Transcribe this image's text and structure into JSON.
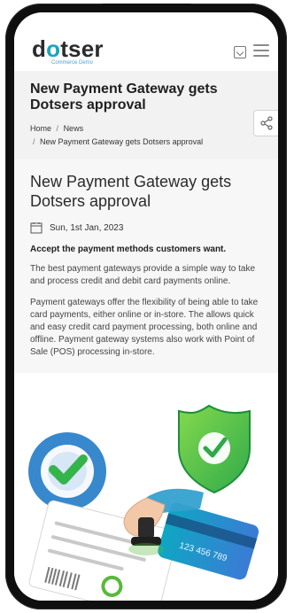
{
  "header": {
    "logo_text": "dotser",
    "logo_subtext": "Commerce Demo",
    "icons": {
      "template": "template-icon",
      "menu": "hamburger-menu-icon"
    }
  },
  "hero": {
    "title": "New Payment Gateway gets Dotsers approval",
    "breadcrumb": {
      "home": "Home",
      "news": "News",
      "current": "New Payment Gateway gets Dotsers approval",
      "separator": "/"
    },
    "share_icon": "share-icon"
  },
  "article": {
    "title": "New Payment Gateway gets Dotsers approval",
    "date": "Sun, 1st Jan, 2023",
    "lead": "Accept the payment methods customers want.",
    "paragraphs": [
      "The best payment gateways provide a simple way to take and process credit and debit card payments online.",
      "Payment gateways offer the flexibility of being able to take card payments, either online or in-store. The allows quick and easy credit card payment processing, both online and offline. Payment gateway systems also work with Point of Sale (POS) processing in-store."
    ]
  },
  "illustration": {
    "card_number": "123 456 789"
  },
  "colors": {
    "brand": "#1aa4bf",
    "text": "#2b2b2b",
    "panel": "#f2f2f2",
    "green": "#58b93b",
    "blue": "#2d7fcc",
    "teal": "#1aa4bf"
  }
}
